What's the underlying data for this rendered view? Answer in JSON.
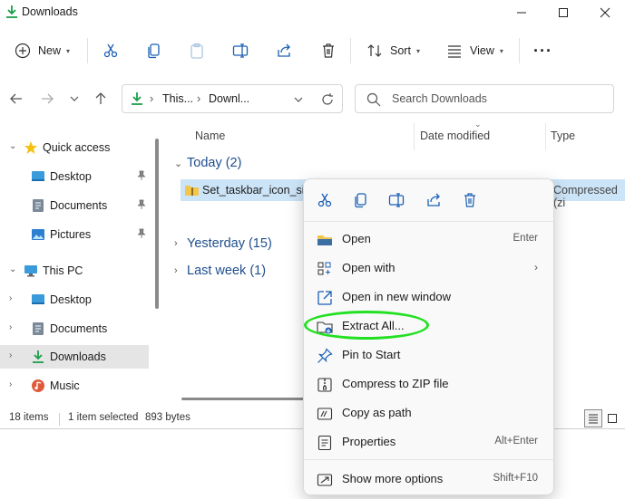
{
  "window": {
    "title": "Downloads",
    "controls": {
      "minimize": "—",
      "maximize": "☐",
      "close": "✕"
    }
  },
  "toolbar": {
    "new_label": "New",
    "sort_label": "Sort",
    "view_label": "View",
    "more_label": "···"
  },
  "address": {
    "crumb1": "This...",
    "crumb2": "Downl...",
    "separator": "›",
    "search_placeholder": "Search Downloads"
  },
  "sidebar": {
    "items": [
      {
        "label": "Quick access",
        "icon": "star-icon"
      },
      {
        "label": "Desktop",
        "icon": "desktop-icon",
        "pinned": true
      },
      {
        "label": "Documents",
        "icon": "documents-icon",
        "pinned": true
      },
      {
        "label": "Pictures",
        "icon": "pictures-icon",
        "pinned": true
      },
      {
        "label": "This PC",
        "icon": "pc-icon"
      },
      {
        "label": "Desktop",
        "icon": "desktop-icon"
      },
      {
        "label": "Documents",
        "icon": "documents-icon"
      },
      {
        "label": "Downloads",
        "icon": "downloads-icon",
        "selected": true
      },
      {
        "label": "Music",
        "icon": "music-icon"
      }
    ]
  },
  "columns": {
    "name": "Name",
    "date_modified": "Date modified",
    "type": "Type"
  },
  "groups": {
    "today": "Today (2)",
    "yesterday": "Yesterday (15)",
    "last_week": "Last week (1)"
  },
  "file": {
    "name": "Set_taskbar_icon_size",
    "type": "Compressed (zi"
  },
  "status": {
    "items": "18 items",
    "selected": "1 item selected",
    "size": "893 bytes"
  },
  "context_menu": {
    "items": [
      {
        "label": "Open",
        "shortcut": "Enter",
        "icon": "folder-open-icon"
      },
      {
        "label": "Open with",
        "shortcut": "",
        "icon": "open-with-icon",
        "submenu": true
      },
      {
        "label": "Open in new window",
        "shortcut": "",
        "icon": "new-window-icon"
      },
      {
        "label": "Extract All...",
        "shortcut": "",
        "icon": "extract-icon"
      },
      {
        "label": "Pin to Start",
        "shortcut": "",
        "icon": "pin-icon"
      },
      {
        "label": "Compress to ZIP file",
        "shortcut": "",
        "icon": "zip-icon"
      },
      {
        "label": "Copy as path",
        "shortcut": "",
        "icon": "copy-path-icon"
      },
      {
        "label": "Properties",
        "shortcut": "Alt+Enter",
        "icon": "properties-icon"
      },
      {
        "label": "Show more options",
        "shortcut": "Shift+F10",
        "icon": "more-options-icon"
      }
    ],
    "submenu_arrow": "›"
  },
  "colors": {
    "accent": "#1f4e8c",
    "selection": "#cce4f7",
    "highlight_ring": "#22e022"
  }
}
